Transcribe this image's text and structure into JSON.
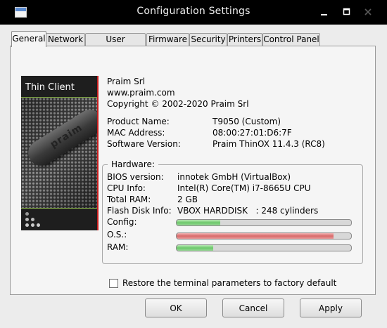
{
  "window": {
    "title": "Configuration Settings",
    "controls": [
      "minimize-icon",
      "maximize-icon",
      "close-icon"
    ]
  },
  "tabs": [
    {
      "label": "General",
      "active": true
    },
    {
      "label": "Network",
      "active": false
    },
    {
      "label": "User Interface",
      "active": false
    },
    {
      "label": "Firmware",
      "active": false
    },
    {
      "label": "Security",
      "active": false
    },
    {
      "label": "Printers",
      "active": false
    },
    {
      "label": "Control Panel",
      "active": false
    }
  ],
  "brand": {
    "title": "Thin Client",
    "logo_text": "praim"
  },
  "company": {
    "name": "Praim Srl",
    "website": "www.praim.com",
    "copyright": "Copyright © 2002-2020 Praim Srl"
  },
  "product": {
    "name_label": "Product Name:",
    "name_value": "T9050 (Custom)",
    "mac_label": "MAC Address:",
    "mac_value": "08:00:27:01:D6:7F",
    "sw_label": "Software Version:",
    "sw_value": "Praim ThinOX 11.4.3 (RC8)"
  },
  "hardware": {
    "title": "Hardware:",
    "bios_label": "BIOS version:",
    "bios_value": "innotek GmbH (VirtualBox)",
    "cpu_label": "CPU Info:",
    "cpu_value": "Intel(R) Core(TM) i7-8665U CPU",
    "ram_label": "Total RAM:",
    "ram_value": "2 GB",
    "flash_label": "Flash Disk Info:",
    "flash_value": "VBOX HARDDISK   : 248 cylinders",
    "usage": [
      {
        "label": "Config:",
        "level": 0.25,
        "color": "#6cc86a"
      },
      {
        "label": "O.S.:",
        "level": 0.9,
        "color": "#d86a6a"
      },
      {
        "label": "RAM:",
        "level": 0.21,
        "color": "#6cc86a"
      }
    ]
  },
  "restore": {
    "label": "Restore the terminal parameters to factory default",
    "checked": false
  },
  "buttons": {
    "ok": "OK",
    "cancel": "Cancel",
    "apply": "Apply"
  },
  "colors": {
    "titlebar": "#000000",
    "accent_red": "#c81e1e",
    "accent_green": "#8ab44a"
  }
}
